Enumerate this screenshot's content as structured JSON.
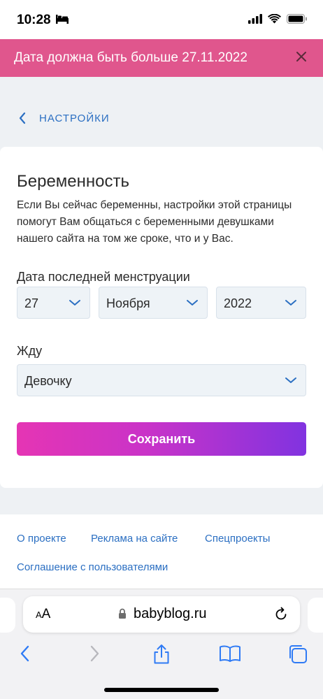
{
  "status_bar": {
    "time": "10:28"
  },
  "toast": {
    "message": "Дата должна быть больше 27.11.2022",
    "close_icon": "close-icon"
  },
  "nav": {
    "back_label": "НАСТРОЙКИ"
  },
  "card": {
    "title": "Беременность",
    "description": "Если Вы сейчас беременны, настройки этой страницы помогут Вам общаться с беременными девушками нашего сайта на том же сроке, что и у Вас.",
    "last_period_label": "Дата последней менструации",
    "day": "27",
    "month": "Ноября",
    "year": "2022",
    "expect_label": "Жду",
    "expect_value": "Девочку",
    "save_label": "Сохранить"
  },
  "footer": {
    "links": [
      "О проекте",
      "Реклама на сайте",
      "Спецпроекты",
      "Соглашение с пользователями"
    ]
  },
  "browser": {
    "text_size_label_small": "A",
    "text_size_label_large": "A",
    "url": "babyblog.ru"
  },
  "colors": {
    "toast": "#e0568d",
    "link": "#2b6fc2",
    "button_start": "#e535b4",
    "button_end": "#8133e0"
  }
}
